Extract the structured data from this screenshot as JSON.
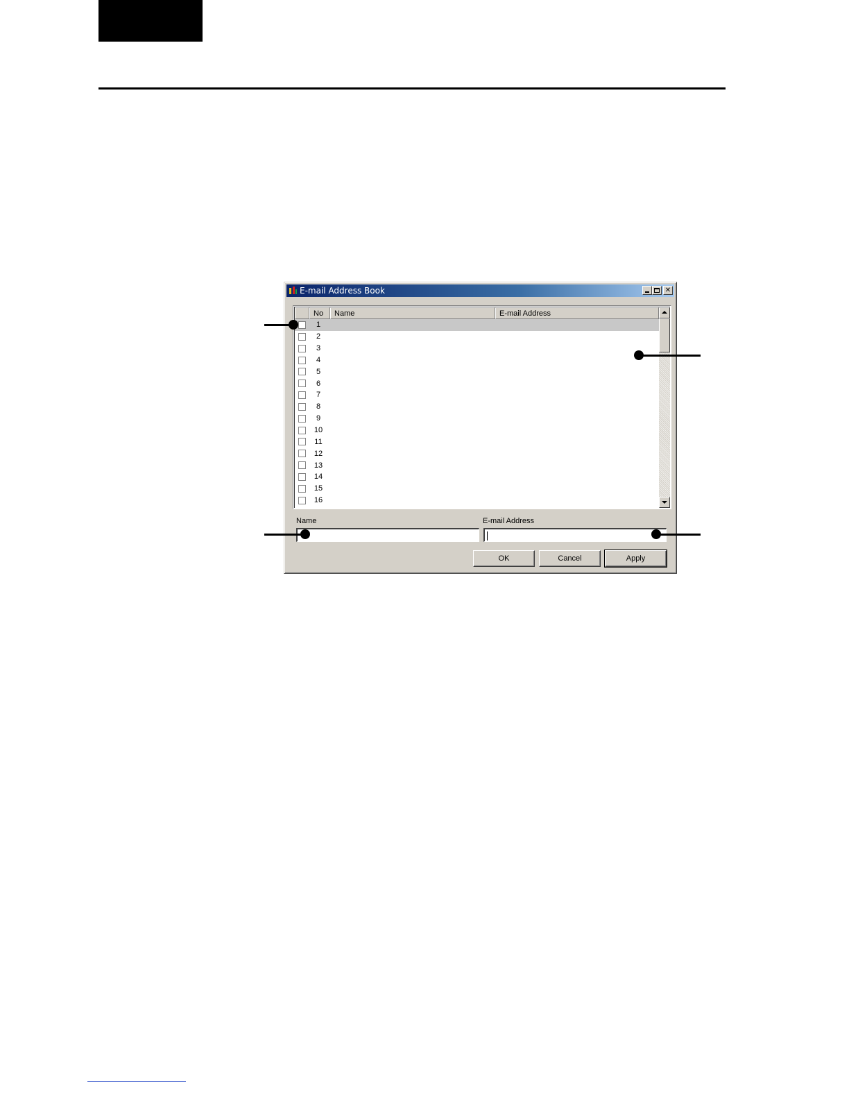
{
  "window": {
    "title": "E-mail Address Book",
    "title_buttons": [
      "minimize-icon",
      "maximize-icon",
      "close-icon"
    ]
  },
  "list": {
    "columns": {
      "check": "",
      "no": "No",
      "name": "Name",
      "email": "E-mail Address"
    },
    "rows": [
      {
        "no": "1",
        "name": "",
        "email": "",
        "selected": true
      },
      {
        "no": "2",
        "name": "",
        "email": ""
      },
      {
        "no": "3",
        "name": "",
        "email": ""
      },
      {
        "no": "4",
        "name": "",
        "email": ""
      },
      {
        "no": "5",
        "name": "",
        "email": ""
      },
      {
        "no": "6",
        "name": "",
        "email": ""
      },
      {
        "no": "7",
        "name": "",
        "email": ""
      },
      {
        "no": "8",
        "name": "",
        "email": ""
      },
      {
        "no": "9",
        "name": "",
        "email": ""
      },
      {
        "no": "10",
        "name": "",
        "email": ""
      },
      {
        "no": "11",
        "name": "",
        "email": ""
      },
      {
        "no": "12",
        "name": "",
        "email": ""
      },
      {
        "no": "13",
        "name": "",
        "email": ""
      },
      {
        "no": "14",
        "name": "",
        "email": ""
      },
      {
        "no": "15",
        "name": "",
        "email": ""
      },
      {
        "no": "16",
        "name": "",
        "email": ""
      }
    ]
  },
  "form": {
    "name_label": "Name",
    "name_value": "",
    "email_label": "E-mail Address",
    "email_value": ""
  },
  "buttons": {
    "ok": "OK",
    "cancel": "Cancel",
    "apply": "Apply"
  },
  "colors": {
    "titlebar_start": "#0a246a",
    "titlebar_end": "#a6caf0",
    "window_face": "#d4d0c8",
    "selected_row": "#c8c8c8"
  }
}
